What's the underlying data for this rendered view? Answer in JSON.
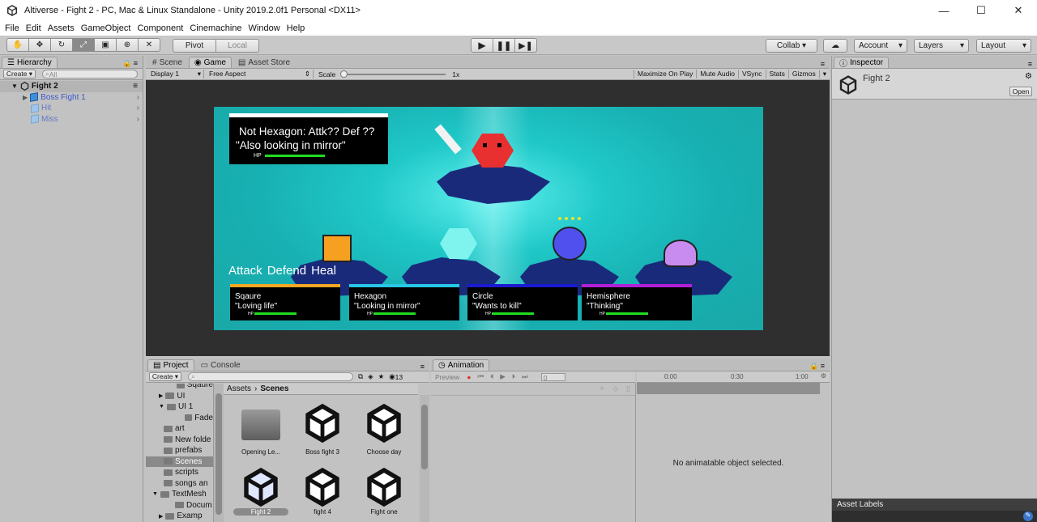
{
  "window": {
    "title": "Altiverse - Fight 2 - PC, Mac & Linux Standalone - Unity 2019.2.0f1 Personal <DX11>",
    "min": "—",
    "max": "☐",
    "close": "✕"
  },
  "menu": [
    "File",
    "Edit",
    "Assets",
    "GameObject",
    "Component",
    "Cinemachine",
    "Window",
    "Help"
  ],
  "toolbar": {
    "pivot": "Pivot",
    "local": "Local",
    "collab": "Collab ▾",
    "account": "Account",
    "layers": "Layers",
    "layout": "Layout"
  },
  "hierarchy": {
    "tab": "Hierarchy",
    "create": "Create ▾",
    "search_placeholder": "All",
    "scene": "Fight 2",
    "items": [
      "Boss Fight 1",
      "Hit",
      "Miss"
    ]
  },
  "game": {
    "tabs": [
      "Scene",
      "Game",
      "Asset Store"
    ],
    "display": "Display 1",
    "aspect": "Free Aspect",
    "scale_label": "Scale",
    "scale_value": "1x",
    "options": [
      "Maximize On Play",
      "Mute Audio",
      "VSync",
      "Stats",
      "Gizmos"
    ]
  },
  "boss_panel": {
    "line1": "Not Hexagon: Attk?? Def ??",
    "line2": "\"Also looking in mirror\"",
    "hp": "HP",
    "hp_fraction": 0.62
  },
  "actions": {
    "attack": "Attack",
    "defend": "Defend",
    "heal": "Heal"
  },
  "party": [
    {
      "name": "Sqaure",
      "quote": "\"Loving life\"",
      "hp": "HP",
      "color": "#f5a623",
      "hp_fraction": 0.65
    },
    {
      "name": "Hexagon",
      "quote": "\"Looking in mirror\"",
      "hp": "HP",
      "color": "#28c6e6",
      "hp_fraction": 0.65
    },
    {
      "name": "Circle",
      "quote": "\"Wants to kill\"",
      "hp": "HP",
      "color": "#1a1ad0",
      "hp_fraction": 0.65
    },
    {
      "name": "Hemisphere",
      "quote": "\"Thinking\"",
      "hp": "HP",
      "color": "#b020d8",
      "hp_fraction": 0.65
    }
  ],
  "inspector": {
    "tab": "Inspector",
    "object": "Fight 2",
    "open": "Open",
    "asset_labels": "Asset Labels"
  },
  "project": {
    "tabs": [
      "Project",
      "Console"
    ],
    "create": "Create ▾",
    "count": "13",
    "tree": [
      "Sqaure",
      "UI",
      "UI 1",
      "Fade",
      "art",
      "New folde",
      "prefabs",
      "Scenes",
      "scripts",
      "songs an",
      "TextMesh",
      "Docum",
      "Examp"
    ],
    "breadcrumb": [
      "Assets",
      "Scenes"
    ],
    "assets": [
      "Opening Le...",
      "Boss fight 3",
      "Choose day",
      "Fight 2",
      "fight 4",
      "Fight one"
    ]
  },
  "animation": {
    "tab": "Animation",
    "preview": "Preview",
    "frame": "0",
    "ticks": [
      "0:00",
      "0:30",
      "1:00"
    ],
    "empty": "No animatable object selected."
  },
  "colors": {
    "game_bg": "#1fb0b0",
    "dark_panel": "#2f2f2f",
    "hp_green": "#22dd22"
  }
}
